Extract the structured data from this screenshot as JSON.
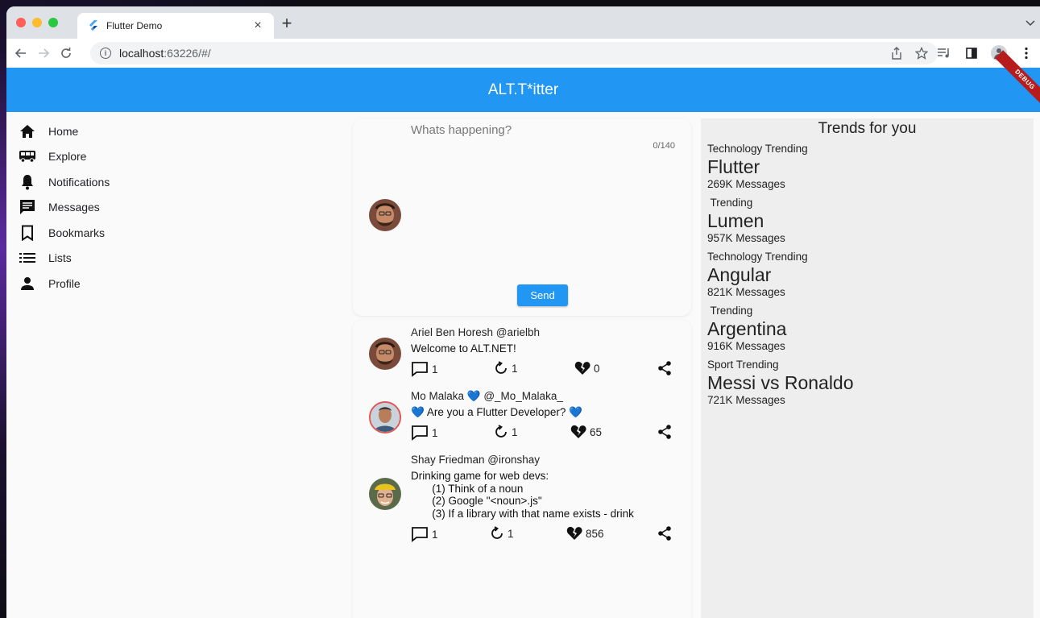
{
  "browser": {
    "tab_title": "Flutter Demo",
    "tab_close": "×",
    "new_tab": "+",
    "tab_menu": "⌄",
    "url_host": "localhost",
    "url_rest": ":63226/#/"
  },
  "app": {
    "title": "ALT.T*itter",
    "debug_banner": "DEBUG",
    "accent_color": "#2196f3"
  },
  "sidebar": {
    "items": [
      {
        "label": "Home",
        "icon": "home-icon"
      },
      {
        "label": "Explore",
        "icon": "bus-icon"
      },
      {
        "label": "Notifications",
        "icon": "bell-icon"
      },
      {
        "label": "Messages",
        "icon": "message-icon"
      },
      {
        "label": "Bookmarks",
        "icon": "bookmark-icon"
      },
      {
        "label": "Lists",
        "icon": "list-icon"
      },
      {
        "label": "Profile",
        "icon": "person-icon"
      }
    ]
  },
  "compose": {
    "placeholder": "Whats happening?",
    "counter": "0/140",
    "send_label": "Send"
  },
  "tweets": [
    {
      "author": "Ariel Ben Horesh @arielbh",
      "body": "Welcome to ALT.NET!",
      "replies": "1",
      "retweets": "1",
      "dislikes": "0"
    },
    {
      "author": "Mo Malaka 💙 @_Mo_Malaka_",
      "body": "💙 Are you a Flutter Developer? 💙",
      "replies": "1",
      "retweets": "1",
      "dislikes": "65"
    },
    {
      "author": "Shay Friedman @ironshay",
      "body": "Drinking game for web devs:\n       (1) Think of a noun\n       (2) Google \"<noun>.js\"\n       (3) If a library with that name exists - drink",
      "replies": "1",
      "retweets": "1",
      "dislikes": "856"
    }
  ],
  "trends": {
    "heading": "Trends for you",
    "items": [
      {
        "category": "Technology Trending",
        "topic": "Flutter",
        "count": "269K Messages"
      },
      {
        "category": " Trending",
        "topic": "Lumen",
        "count": "957K Messages"
      },
      {
        "category": "Technology Trending",
        "topic": "Angular",
        "count": "821K Messages"
      },
      {
        "category": " Trending",
        "topic": "Argentina",
        "count": "916K Messages"
      },
      {
        "category": "Sport Trending",
        "topic": "Messi vs Ronaldo",
        "count": "721K Messages"
      }
    ]
  }
}
